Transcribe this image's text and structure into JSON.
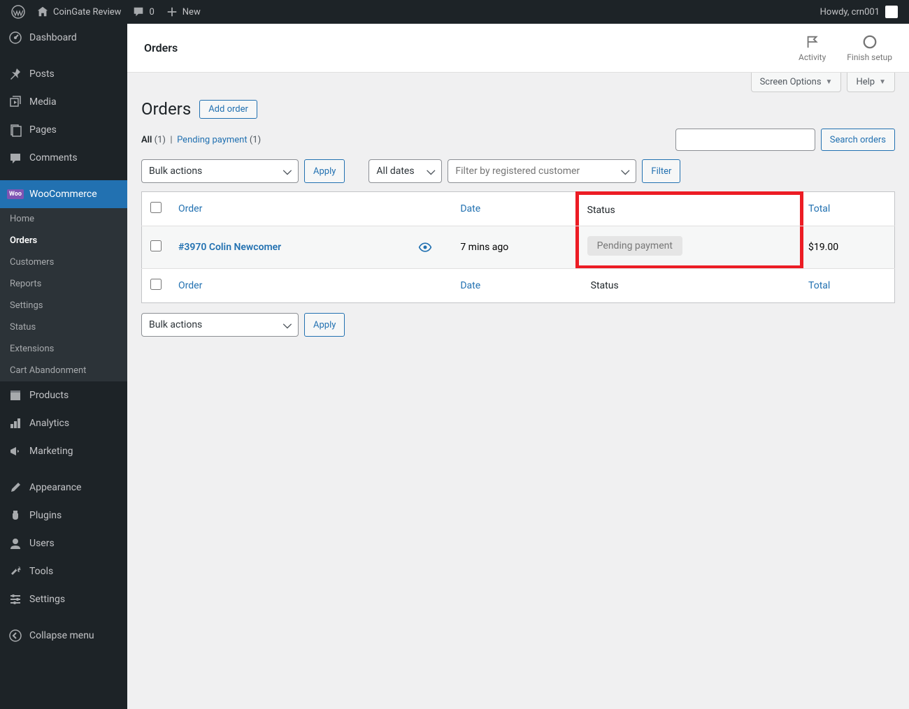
{
  "adminbar": {
    "site_name": "CoinGate Review",
    "comments_count": "0",
    "new_label": "New",
    "howdy": "Howdy, crn001"
  },
  "sidebar": {
    "dashboard": "Dashboard",
    "posts": "Posts",
    "media": "Media",
    "pages": "Pages",
    "comments": "Comments",
    "woocommerce": "WooCommerce",
    "woo_sub": {
      "home": "Home",
      "orders": "Orders",
      "customers": "Customers",
      "reports": "Reports",
      "settings": "Settings",
      "status": "Status",
      "extensions": "Extensions",
      "cart_abandonment": "Cart Abandonment"
    },
    "products": "Products",
    "analytics": "Analytics",
    "marketing": "Marketing",
    "appearance": "Appearance",
    "plugins": "Plugins",
    "users": "Users",
    "tools": "Tools",
    "settings": "Settings",
    "collapse": "Collapse menu"
  },
  "topbar": {
    "title": "Orders",
    "activity": "Activity",
    "finish_setup": "Finish setup"
  },
  "tabs": {
    "screen_options": "Screen Options",
    "help": "Help"
  },
  "page": {
    "title": "Orders",
    "add_order": "Add order"
  },
  "subsub": {
    "all": "All",
    "all_count": "(1)",
    "sep": "|",
    "pending": "Pending payment",
    "pending_count": "(1)"
  },
  "search": {
    "button": "Search orders"
  },
  "filters": {
    "bulk": "Bulk actions",
    "apply": "Apply",
    "dates": "All dates",
    "customer_placeholder": "Filter by registered customer",
    "filter": "Filter"
  },
  "table": {
    "order": "Order",
    "date": "Date",
    "status": "Status",
    "total": "Total"
  },
  "rows": [
    {
      "order": "#3970 Colin Newcomer",
      "date": "7 mins ago",
      "status": "Pending payment",
      "total": "$19.00"
    }
  ]
}
